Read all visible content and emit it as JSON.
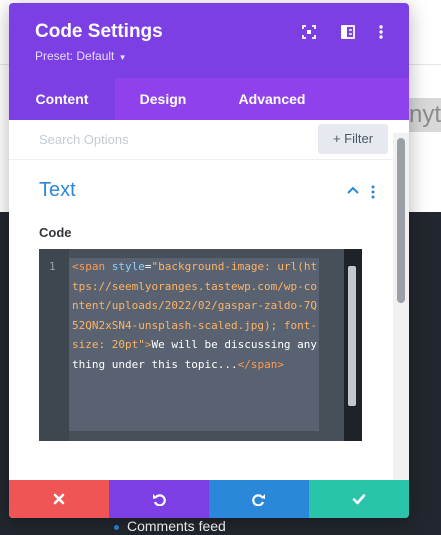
{
  "background": {
    "hint_text": "nyth",
    "footer_link": "Comments feed"
  },
  "modal": {
    "title": "Code Settings",
    "preset": "Preset: Default",
    "header_icons": [
      "expand-icon",
      "sidebar-layout-icon",
      "more-vertical-icon"
    ],
    "tabs": [
      {
        "label": "Content",
        "active": true
      },
      {
        "label": "Design",
        "active": false
      },
      {
        "label": "Advanced",
        "active": false
      }
    ],
    "search": {
      "placeholder": "Search Options"
    },
    "filter_button": "+ Filter",
    "section": {
      "title": "Text",
      "field_label": "Code",
      "line_number": "1",
      "code": {
        "tag_open_start": "<span",
        "attr": " style",
        "eq": "=",
        "value": "\"background-image: url(https://seemlyoranges.tastewp.com/wp-content/uploads/2022/02/gaspar-zaldo-7Q52QN2xSN4-unsplash-scaled.jpg); font-size: 20pt\"",
        "tag_open_end": ">",
        "content": "We will be discussing anything under this topic...",
        "tag_close": "</span>"
      }
    },
    "actions": [
      {
        "name": "cancel",
        "icon": "close-icon",
        "color": "#ef5555"
      },
      {
        "name": "undo",
        "icon": "undo-icon",
        "color": "#7b3fe4"
      },
      {
        "name": "redo",
        "icon": "redo-icon",
        "color": "#2b87da"
      },
      {
        "name": "save",
        "icon": "check-icon",
        "color": "#29c4a9"
      }
    ]
  }
}
